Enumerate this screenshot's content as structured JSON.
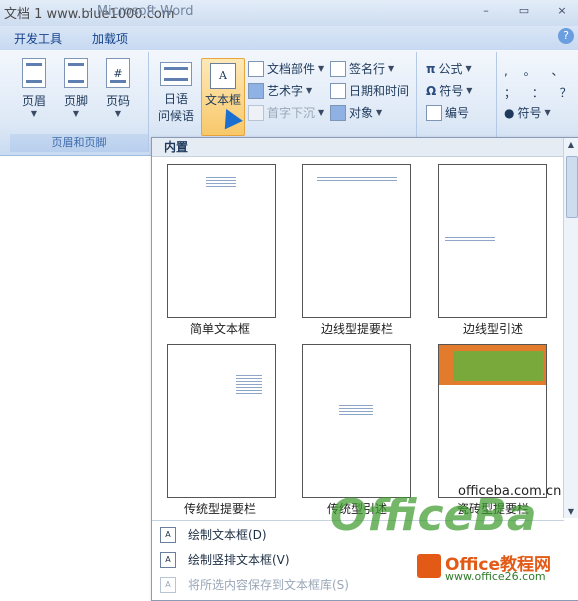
{
  "titlebar": {
    "watermark": "文档 1 www.blue1000.com",
    "app_title": "- Microsoft Word",
    "minimize": "–",
    "restore": "▭",
    "close": "×"
  },
  "tabs": [
    "开发工具",
    "加载项"
  ],
  "help": "?",
  "ribbon": {
    "header_footer_group": {
      "label": "页眉和页脚",
      "header": "页眉",
      "footer": "页脚",
      "page_number": "页码"
    },
    "japanese": {
      "line1": "日语",
      "line2": "问候语"
    },
    "textbox": "文本框",
    "quick_parts": "文档部件",
    "wordart": "艺术字",
    "dropcap": "首字下沉",
    "signature": "签名行",
    "datetime": "日期和时间",
    "object": "对象",
    "equation": "公式",
    "symbol": "符号",
    "numbering": "编号",
    "special_symbol": "符号",
    "special_chars_row1": ", 。 、 ·",
    "special_chars_row2": "； ： ？"
  },
  "gallery": {
    "header": "内置",
    "items": [
      {
        "label": "简单文本框"
      },
      {
        "label": "边线型提要栏"
      },
      {
        "label": "边线型引述"
      },
      {
        "label": "传统型提要栏"
      },
      {
        "label": "传统型引述"
      },
      {
        "label": "瓷砖型提要栏"
      }
    ],
    "menu": [
      {
        "label": "绘制文本框(D)"
      },
      {
        "label": "绘制竖排文本框(V)"
      },
      {
        "label": "将所选内容保存到文本框库(S)"
      }
    ]
  },
  "logo": {
    "site": "officeba.com.cn",
    "big": "OfficeBa",
    "cn": "Office教程网",
    "url": "www.office26.com"
  }
}
